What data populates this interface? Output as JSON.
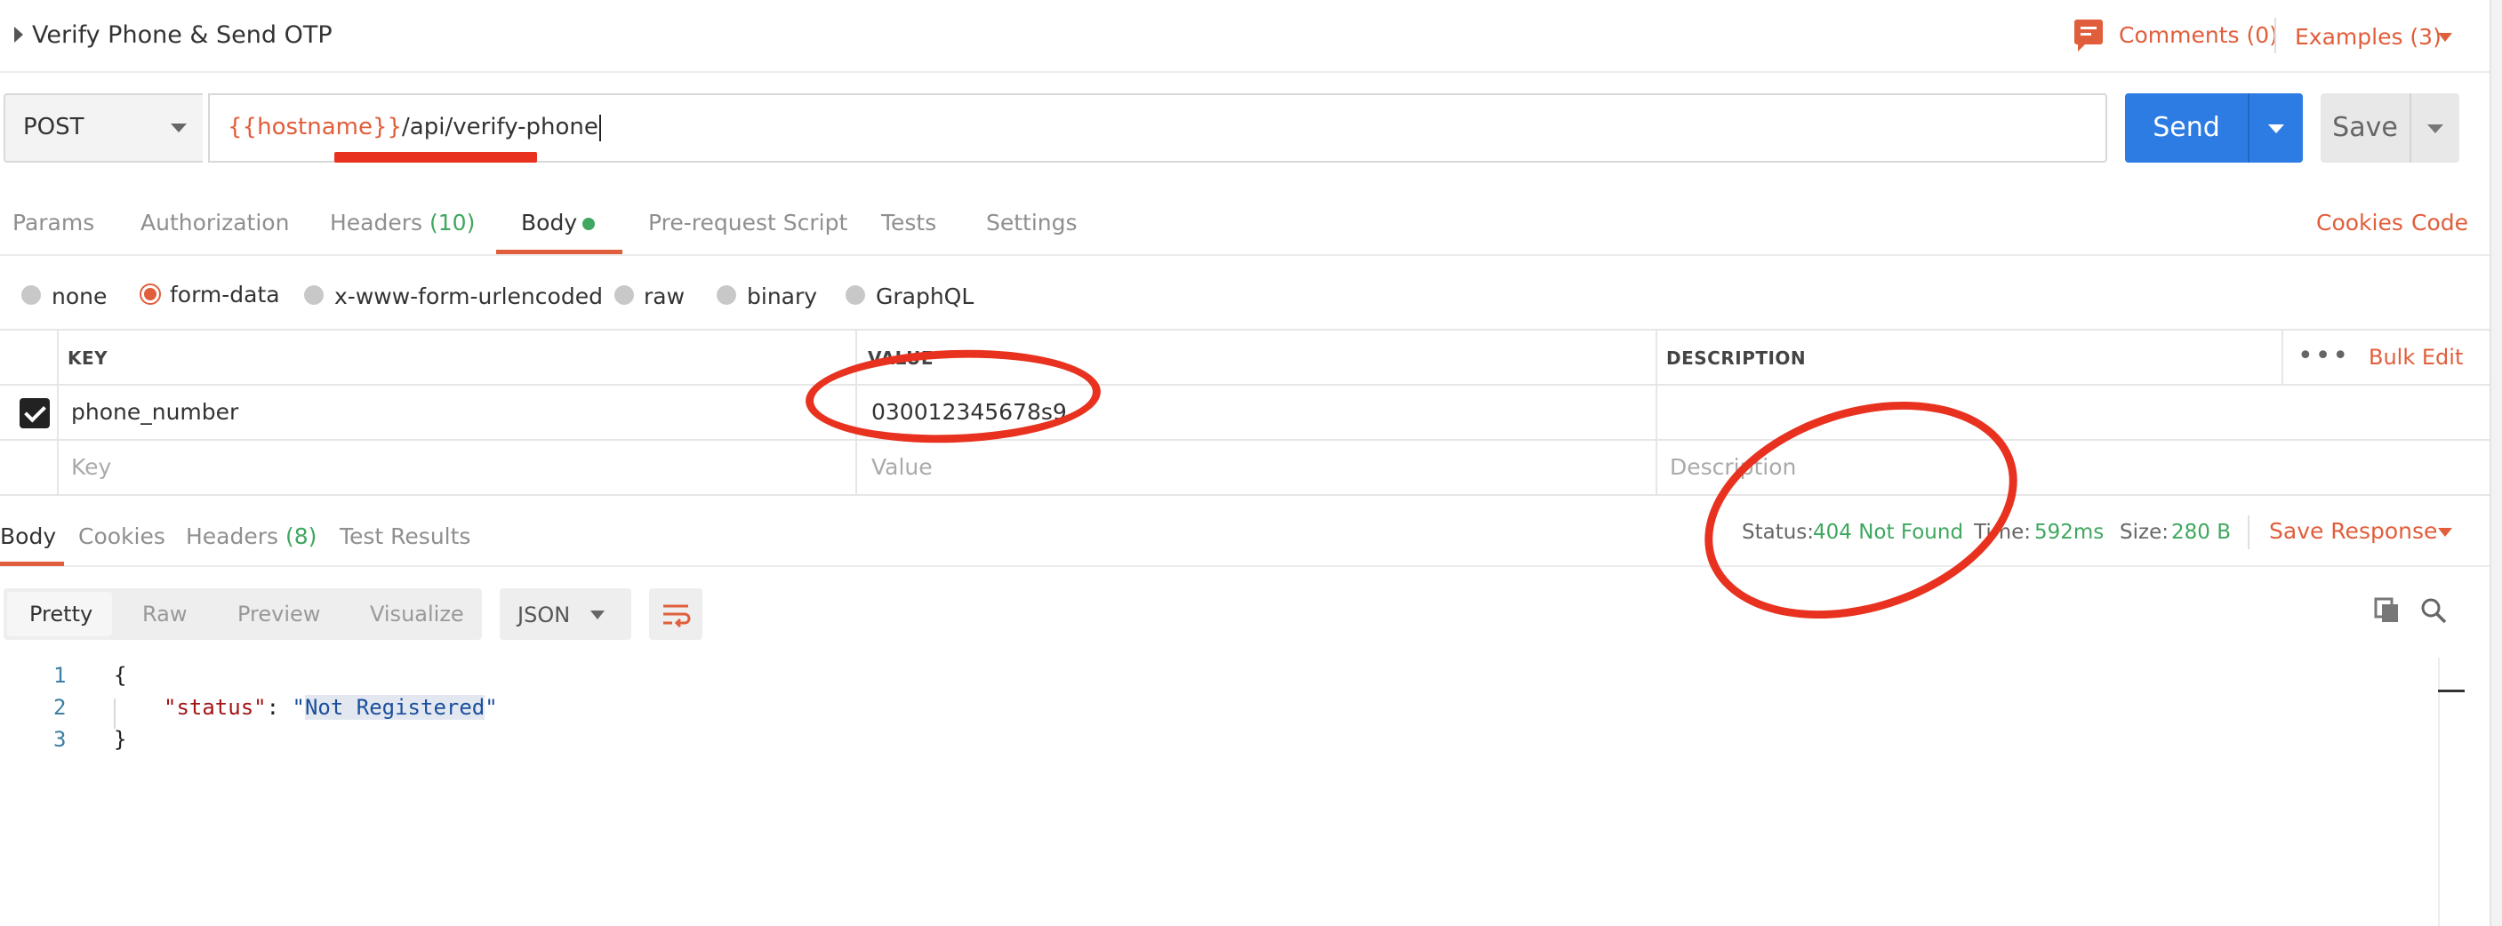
{
  "request": {
    "title": "Verify Phone & Send OTP",
    "comments_label": "Comments (0)",
    "examples_label": "Examples (3)",
    "method": "POST",
    "url_variable": "{{hostname}}",
    "url_path": "/api/verify-phone",
    "send_label": "Send",
    "save_label": "Save"
  },
  "request_tabs": {
    "params": "Params",
    "authorization": "Authorization",
    "headers": "Headers",
    "headers_count": "(10)",
    "body": "Body",
    "prerequest": "Pre-request Script",
    "tests": "Tests",
    "settings": "Settings",
    "cookies": "Cookies",
    "code": "Code",
    "active": "Body"
  },
  "body_types": {
    "none": "none",
    "form_data": "form-data",
    "urlencoded": "x-www-form-urlencoded",
    "raw": "raw",
    "binary": "binary",
    "graphql": "GraphQL",
    "selected": "form-data"
  },
  "kv_table": {
    "headers": {
      "key": "KEY",
      "value": "VALUE",
      "description": "DESCRIPTION"
    },
    "bulk_edit": "Bulk Edit",
    "more": "•••",
    "rows": [
      {
        "checked": true,
        "key": "phone_number",
        "value": "030012345678s9",
        "description": ""
      }
    ],
    "placeholders": {
      "key": "Key",
      "value": "Value",
      "description": "Description"
    }
  },
  "response_tabs": {
    "body": "Body",
    "cookies": "Cookies",
    "headers": "Headers",
    "headers_count": "(8)",
    "test_results": "Test Results",
    "active": "Body"
  },
  "response_meta": {
    "status_label": "Status:",
    "status_value": "404 Not Found",
    "time_label": "Time:",
    "time_value": "592ms",
    "size_label": "Size:",
    "size_value": "280 B",
    "save_response": "Save Response"
  },
  "response_view": {
    "modes": [
      "Pretty",
      "Raw",
      "Preview",
      "Visualize"
    ],
    "active_mode": "Pretty",
    "format": "JSON"
  },
  "response_body": {
    "lines": [
      {
        "num": "1",
        "text": "{"
      },
      {
        "num": "2",
        "key": "\"status\"",
        "sep": ": ",
        "q1": "\"",
        "value": "Not Registered",
        "q2": "\""
      },
      {
        "num": "3",
        "text": "}"
      }
    ]
  },
  "colors": {
    "accent": "#e05e3b",
    "primary_button": "#2d7ce3",
    "success": "#3fa75f",
    "annotation": "#e8321f"
  }
}
